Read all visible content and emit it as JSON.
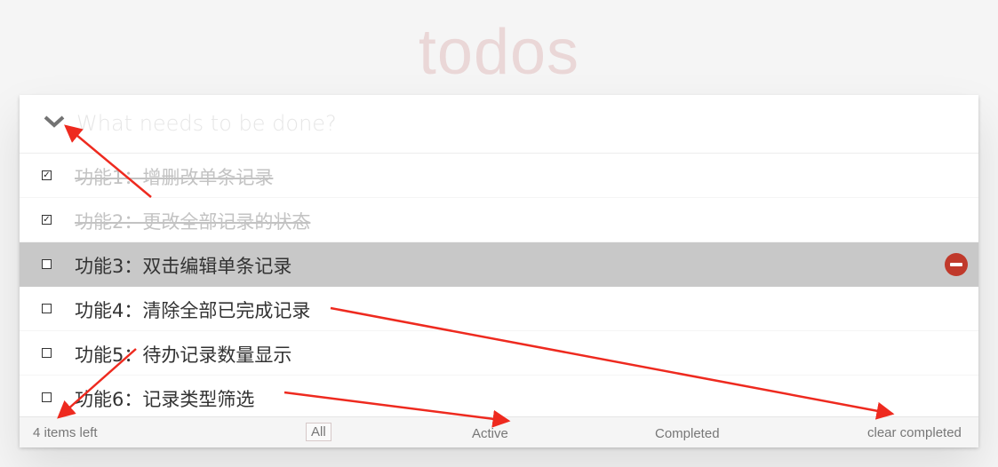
{
  "app": {
    "title": "todos"
  },
  "input": {
    "placeholder": "What needs to be done?"
  },
  "todos": [
    {
      "label": "功能1：增删改单条记录",
      "completed": true
    },
    {
      "label": "功能2：更改全部记录的状态",
      "completed": true
    },
    {
      "label": "功能3：双击编辑单条记录",
      "completed": false
    },
    {
      "label": "功能4：清除全部已完成记录",
      "completed": false
    },
    {
      "label": "功能5：待办记录数量显示",
      "completed": false
    },
    {
      "label": "功能6：记录类型筛选",
      "completed": false
    }
  ],
  "footer": {
    "count": "4 items left",
    "filters": [
      "All",
      "Active",
      "Completed"
    ],
    "clear": "clear completed"
  },
  "icons": {
    "toggle": "chevron-down-icon",
    "check": "☑",
    "destroy": "minus-circle-icon"
  },
  "colors": {
    "title": "#efd5d5",
    "annotation": "#ee2a1f",
    "destroy": "#c0392b",
    "hover": "#c8c8c8"
  }
}
